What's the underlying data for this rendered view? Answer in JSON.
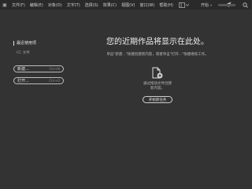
{
  "menubar": {
    "logo_icon": "app-logo-icon",
    "items": [
      "文件(F)",
      "编辑(E)",
      "对象(O)",
      "文字(T)",
      "选择(S)",
      "效果(C)",
      "视图(V)",
      "窗口(W)",
      "帮助(H)"
    ],
    "workspace_label": "开始",
    "icons": [
      "layout-icon",
      "send-icon",
      "search-icon"
    ]
  },
  "sidebar": {
    "recent_title": "最近使用项",
    "cc_files": "CC 文件",
    "new_button": {
      "label": "新建...",
      "shortcut": "Ctrl+N"
    },
    "open_button": {
      "label": "打开...",
      "shortcut": "Ctrl+O"
    }
  },
  "main": {
    "headline": "您的近期作品将显示在此处。",
    "description": "单击\"新建...\"快捷创建新内容，或者单击\"打开...\"快捷继续工作。",
    "drop_text_line1": "通过拖动文件创建",
    "drop_text_line2": "新内容。",
    "start_button": "开始新任务"
  }
}
